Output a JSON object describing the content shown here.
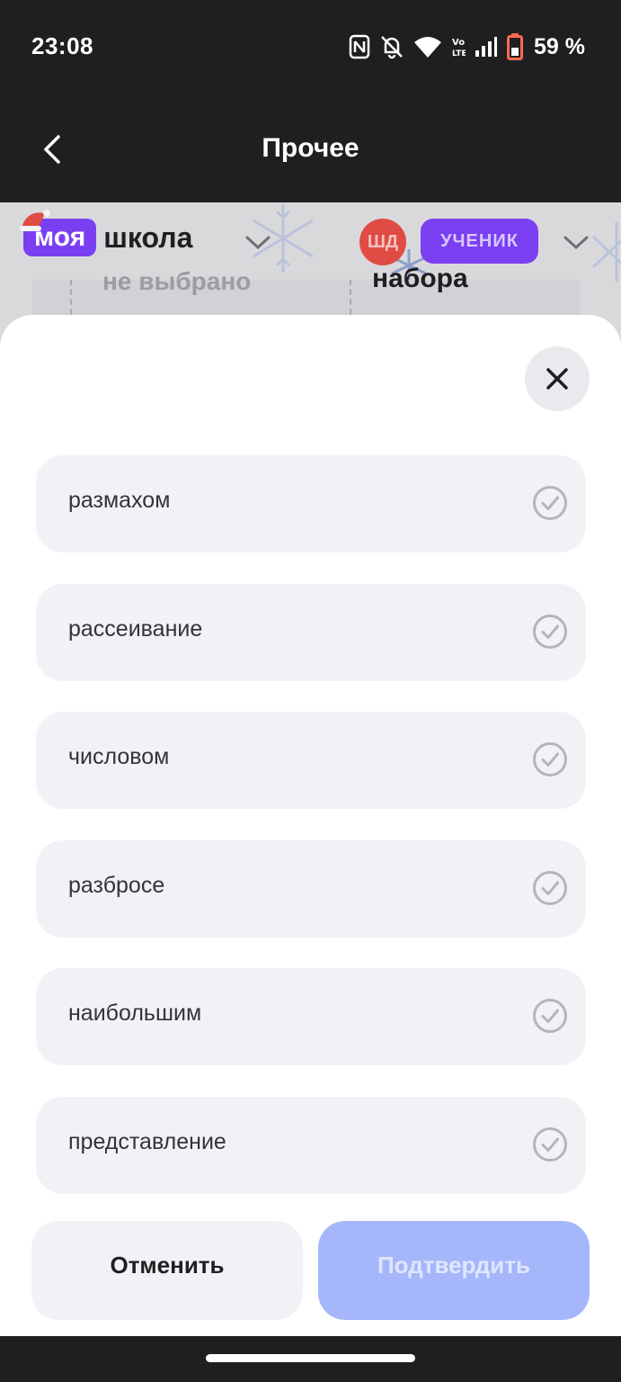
{
  "status_bar": {
    "time": "23:08",
    "battery": "59 %",
    "icons": [
      "nfc-icon",
      "bell-off-icon",
      "wifi-icon",
      "volte-icon",
      "signal-icon",
      "battery-icon"
    ]
  },
  "header": {
    "title": "Прочее",
    "back_icon": "chevron-left-icon"
  },
  "background_page": {
    "logo_part1": "моя",
    "logo_part2": "школа",
    "avatar_initials": "ШД",
    "role": "УЧЕНИК",
    "select_value": "не выбрано",
    "bold_text": "набора"
  },
  "sheet": {
    "options": [
      {
        "label": "размахом"
      },
      {
        "label": "рассеивание"
      },
      {
        "label": "числовом"
      },
      {
        "label": "разбросе"
      },
      {
        "label": "наибольшим"
      },
      {
        "label": "представление"
      }
    ],
    "cancel_label": "Отменить",
    "confirm_label": "Подтвердить"
  },
  "colors": {
    "dark": "#1f1f22",
    "brand_purple": "#7b3ff2",
    "option_bg": "#f2f2f6",
    "confirm_disabled": "#a5b7fa",
    "avatar_red": "#e04b43"
  }
}
